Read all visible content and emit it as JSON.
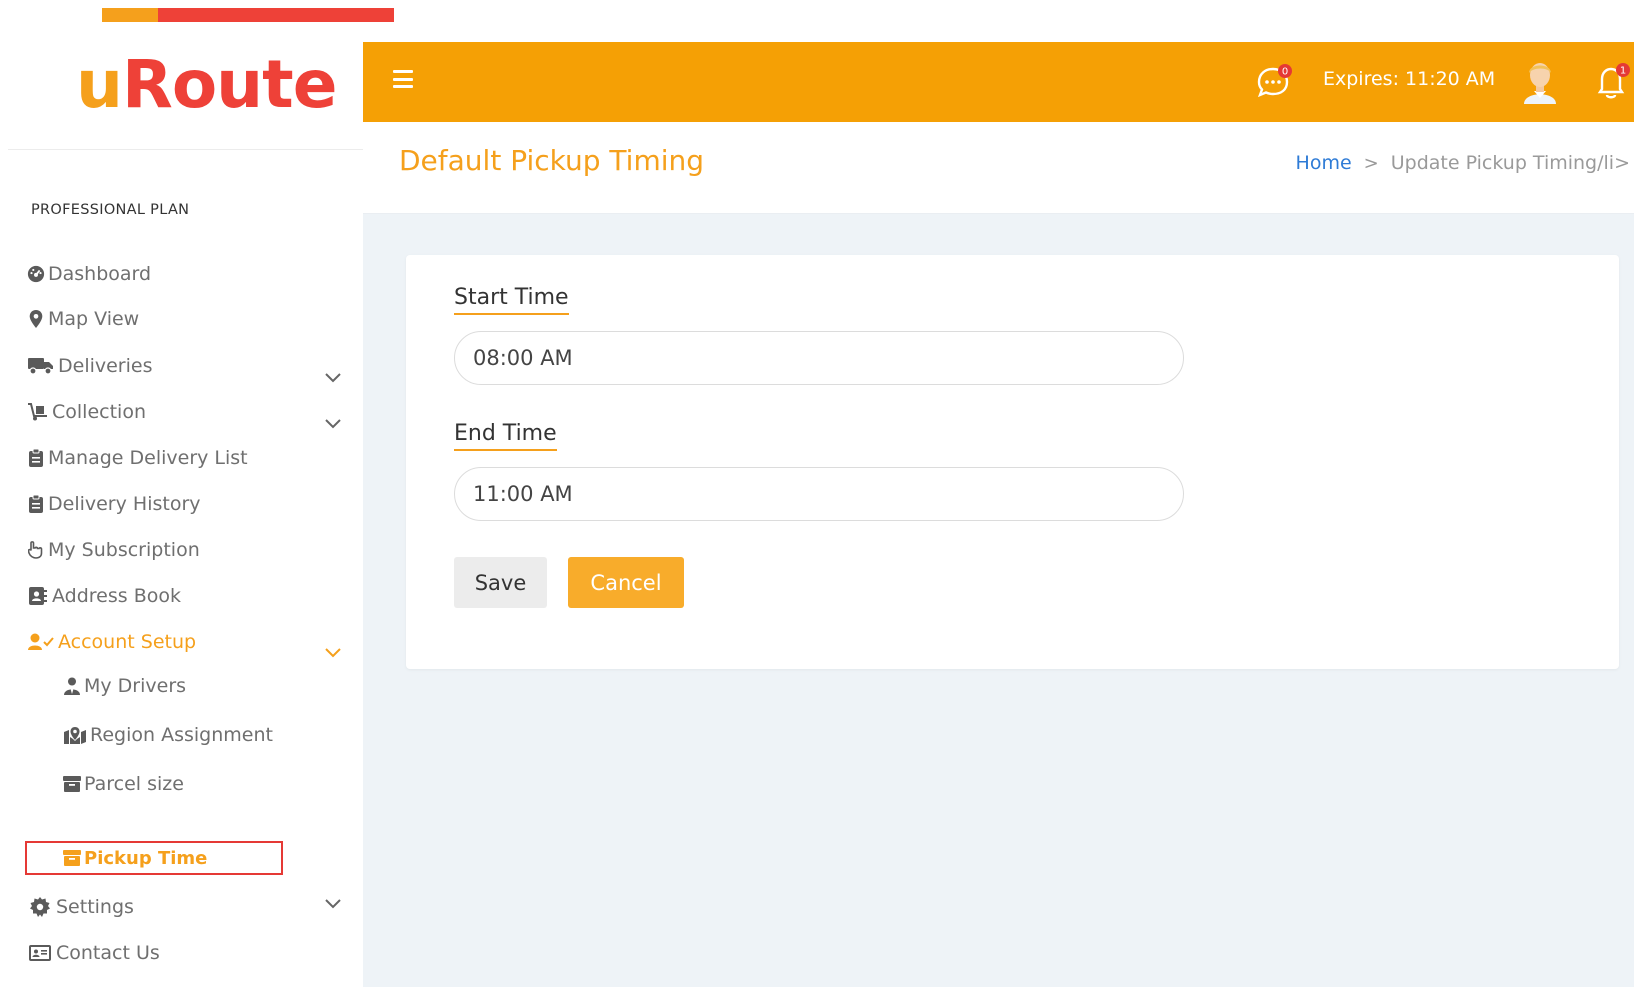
{
  "brand": {
    "logo_u": "u",
    "logo_rest": "Route",
    "colors": {
      "primary": "#f5a005",
      "accent_red": "#ee4138",
      "link": "#2e7bd6"
    }
  },
  "sidebar": {
    "plan_label": "PROFESSIONAL PLAN",
    "items": [
      {
        "label": "Dashboard",
        "icon": "dashboard-icon"
      },
      {
        "label": "Map View",
        "icon": "map-marker-icon"
      },
      {
        "label": "Deliveries",
        "icon": "truck-icon",
        "expandable": true
      },
      {
        "label": "Collection",
        "icon": "dolly-icon",
        "expandable": true
      },
      {
        "label": "Manage Delivery List",
        "icon": "clipboard-icon"
      },
      {
        "label": "Delivery History",
        "icon": "clipboard-icon"
      },
      {
        "label": "My Subscription",
        "icon": "hand-icon"
      },
      {
        "label": "Address Book",
        "icon": "address-book-icon"
      },
      {
        "label": "Account Setup",
        "icon": "user-check-icon",
        "expandable": true,
        "expanded": true
      },
      {
        "label": "Settings",
        "icon": "gear-icon",
        "expandable": true
      },
      {
        "label": "Contact Us",
        "icon": "id-card-icon"
      }
    ],
    "account_setup_children": [
      {
        "label": "My Drivers",
        "icon": "user-tie-icon"
      },
      {
        "label": "Region Assignment",
        "icon": "map-location-icon"
      },
      {
        "label": "Parcel size",
        "icon": "box-icon"
      },
      {
        "label": "Pickup Time",
        "icon": "box-icon",
        "current": true
      }
    ]
  },
  "header": {
    "menu_icon": "hamburger-icon",
    "chat_icon": "chat-bubble-icon",
    "chat_badge": "0",
    "expires_text": "Expires: 11:20 AM",
    "avatar_icon": "user-avatar-icon",
    "bell_icon": "bell-icon",
    "bell_badge": "1"
  },
  "page": {
    "title": "Default Pickup Timing",
    "breadcrumb": {
      "home": "Home",
      "separator": ">",
      "current": "Update Pickup Timing/li>"
    }
  },
  "form": {
    "start_label": "Start Time",
    "start_value": "08:00 AM",
    "end_label": "End Time",
    "end_value": "11:00 AM",
    "save_label": "Save",
    "cancel_label": "Cancel"
  }
}
